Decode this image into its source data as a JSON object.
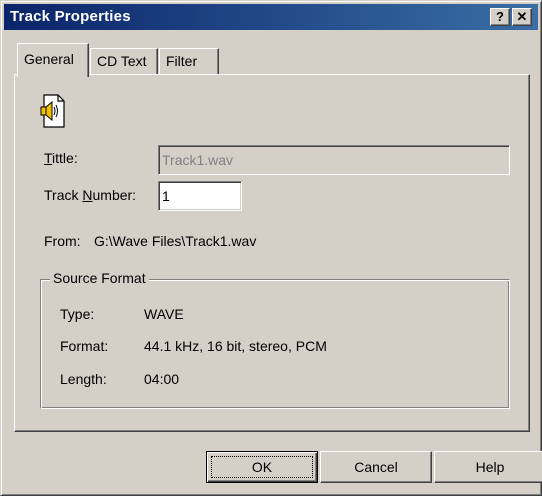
{
  "window": {
    "title": "Track Properties",
    "help_glyph": "?",
    "close_glyph": "✕"
  },
  "tabs": [
    {
      "label": "General",
      "active": true
    },
    {
      "label": "CD Text",
      "active": false
    },
    {
      "label": "Filter",
      "active": false
    }
  ],
  "general": {
    "icon": "audio-file-icon",
    "title_label_first": "T",
    "title_label_rest": "ittle:",
    "title_value": "Track1.wav",
    "track_number_label_pre": "Track ",
    "track_number_label_u": "N",
    "track_number_label_post": "umber:",
    "track_number_value": "1",
    "from_label": "From:",
    "from_value": "G:\\Wave Files\\Track1.wav",
    "source_format": {
      "legend": "Source Format",
      "rows": [
        {
          "label": "Type:",
          "value": "WAVE"
        },
        {
          "label": "Format:",
          "value": "44.1 kHz, 16 bit, stereo, PCM"
        },
        {
          "label": "Length:",
          "value": "04:00"
        }
      ]
    }
  },
  "buttons": {
    "ok": "OK",
    "cancel": "Cancel",
    "help": "Help"
  }
}
